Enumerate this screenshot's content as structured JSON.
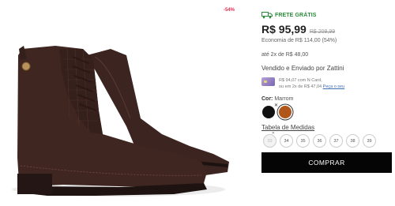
{
  "product": {
    "discount_badge": "-54%",
    "image_alt": "Bota feminina de couro marrom com cadarço"
  },
  "shipping": {
    "label": "FRETE GRÁTIS",
    "icon": "truck-icon"
  },
  "pricing": {
    "price": "R$ 95,99",
    "old_price": "R$ 209,99",
    "savings": "Economia de R$ 114,00 (54%)",
    "installments": "até 2x de R$ 48,00"
  },
  "seller": {
    "text": "Vendido e Enviado por Zattini"
  },
  "card_offer": {
    "line1": "R$ 94,07 com N Card,",
    "line2": "ou em 2x de R$ 47,04",
    "link": "Peça o seu"
  },
  "color": {
    "label": "Cor:",
    "value": "Marrom",
    "swatches": [
      {
        "name": "Preto",
        "hex": "#111111",
        "unavailable": true
      },
      {
        "name": "Marrom",
        "hex": "#b0561b",
        "selected": true
      }
    ]
  },
  "sizes": {
    "table_link": "Tabela de Medidas",
    "options": [
      {
        "label": "33",
        "unavailable": true
      },
      {
        "label": "34"
      },
      {
        "label": "35"
      },
      {
        "label": "36"
      },
      {
        "label": "37"
      },
      {
        "label": "38"
      },
      {
        "label": "39"
      }
    ]
  },
  "actions": {
    "buy_label": "COMPRAR"
  },
  "colors": {
    "accent_green": "#2a8a3a",
    "discount_red": "#e0284f",
    "button_black": "#050505"
  }
}
